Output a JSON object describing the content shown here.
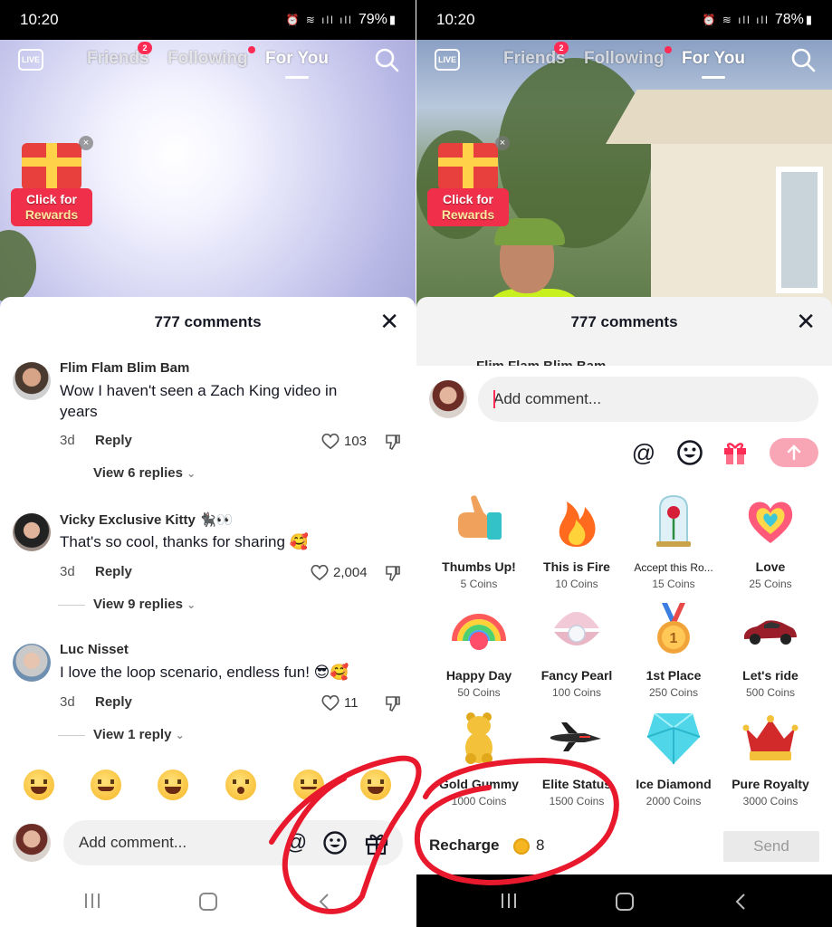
{
  "status_left": {
    "time": "10:20",
    "battery": "79%"
  },
  "status_right": {
    "time": "10:20",
    "battery": "78%"
  },
  "top_nav": {
    "live": "LIVE",
    "friends": "Friends",
    "friends_badge": "2",
    "following": "Following",
    "for_you": "For You"
  },
  "rewards": {
    "line1": "Click for",
    "line2": "Rewards"
  },
  "sheet_title": "777 comments",
  "comments": [
    {
      "user": "Flim Flam Blim Bam",
      "text": "Wow I haven't seen a Zach King video in years",
      "age": "3d",
      "reply": "Reply",
      "likes": "103",
      "view_replies": "View 6 replies"
    },
    {
      "user": "Vicky Exclusive Kitty 🐈‍⬛👀",
      "text": "That's so cool, thanks for sharing 🥰",
      "age": "3d",
      "reply": "Reply",
      "likes": "2,004",
      "view_replies": "View 9 replies"
    },
    {
      "user": "Luc Nisset",
      "text": "I love the loop scenario, endless fun! 😎🥰",
      "age": "3d",
      "reply": "Reply",
      "likes": "11",
      "view_replies": "View 1 reply"
    }
  ],
  "peek_user": "Flim Flam Blim Bam",
  "input_placeholder": "Add comment...",
  "gifts": [
    {
      "name": "Thumbs Up!",
      "coins": "5 Coins",
      "icon": "thumbs-up-icon"
    },
    {
      "name": "This is Fire",
      "coins": "10 Coins",
      "icon": "fire-icon"
    },
    {
      "name": "Accept this Ro...",
      "coins": "15 Coins",
      "icon": "rose-dome-icon"
    },
    {
      "name": "Love",
      "coins": "25 Coins",
      "icon": "heart-icon"
    },
    {
      "name": "Happy Day",
      "coins": "50 Coins",
      "icon": "rainbow-icon"
    },
    {
      "name": "Fancy Pearl",
      "coins": "100 Coins",
      "icon": "pearl-icon"
    },
    {
      "name": "1st Place",
      "coins": "250 Coins",
      "icon": "medal-icon"
    },
    {
      "name": "Let's ride",
      "coins": "500 Coins",
      "icon": "car-icon"
    },
    {
      "name": "Gold Gummy",
      "coins": "1000 Coins",
      "icon": "gummy-bear-icon"
    },
    {
      "name": "Elite Status",
      "coins": "1500 Coins",
      "icon": "jet-icon"
    },
    {
      "name": "Ice Diamond",
      "coins": "2000 Coins",
      "icon": "diamond-icon"
    },
    {
      "name": "Pure Royalty",
      "coins": "3000 Coins",
      "icon": "crown-icon"
    }
  ],
  "recharge": {
    "label": "Recharge",
    "balance": "8",
    "send": "Send"
  },
  "colors": {
    "accent": "#fe2c55",
    "annotation": "#e8192c",
    "send_disabled": "#f8a6b6"
  }
}
